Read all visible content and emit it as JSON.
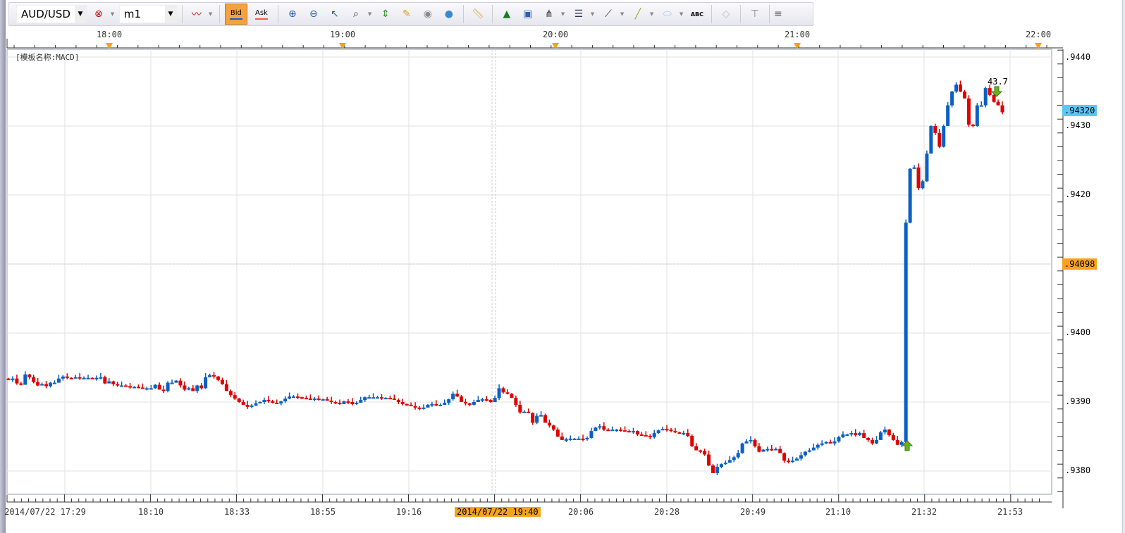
{
  "toolbar": {
    "symbol": "AUD/USD",
    "timeframe": "m1",
    "bid_label": "Bid",
    "ask_label": "Ask",
    "icons": [
      "delete-link-icon",
      "chart-type-icon",
      "zoom-in-icon",
      "zoom-out-icon",
      "pointer-icon",
      "zoom-range-icon",
      "vertical-fit-icon",
      "edit-icon",
      "view-icon",
      "globe-icon",
      "ruler-icon",
      "add-image-icon",
      "window-chart-icon",
      "fork-icon",
      "fib-lines-icon",
      "fan-icon",
      "line-tool-icon",
      "ellipse-icon",
      "text-tool-icon",
      "eraser-icon",
      "hierarchy-icon"
    ]
  },
  "colors": {
    "up": "#0a5fc4",
    "down": "#e00000",
    "current": "#5bc6f5",
    "cross": "#f7a21a",
    "grid": "#e2e2e2"
  },
  "top_axis": {
    "labels": [
      "18:00",
      "19:00",
      "20:00",
      "21:00",
      "22:00"
    ]
  },
  "template_label": "[模板名称:MACD]",
  "price_axis": {
    "labels": [
      ".9440",
      ".9430",
      ".9420",
      ".9400",
      ".9390",
      ".9380"
    ],
    "current": ".94320",
    "crosshair": ".94098"
  },
  "time_axis": {
    "labels": [
      "2014/07/22 17:29",
      "18:10",
      "18:33",
      "18:55",
      "19:16",
      "20:06",
      "20:28",
      "20:49",
      "21:10",
      "21:32",
      "21:53"
    ],
    "crosshair": "2014/07/22 19:40"
  },
  "marker_label": "43.7",
  "chart_data": {
    "type": "candlestick",
    "ylim": [
      0.9377,
      0.9442
    ],
    "closes": [
      0.93932,
      0.93934,
      0.93927,
      0.93925,
      0.9394,
      0.93936,
      0.93929,
      0.93924,
      0.93926,
      0.93923,
      0.93928,
      0.93928,
      0.93934,
      0.93937,
      0.93935,
      0.93934,
      0.93936,
      0.93935,
      0.93935,
      0.93935,
      0.93934,
      0.93935,
      0.93936,
      0.93927,
      0.9393,
      0.93926,
      0.93924,
      0.93924,
      0.93923,
      0.93922,
      0.93922,
      0.93921,
      0.9392,
      0.9392,
      0.9392,
      0.93925,
      0.93918,
      0.93916,
      0.93928,
      0.93928,
      0.93931,
      0.93924,
      0.93918,
      0.9392,
      0.93916,
      0.93924,
      0.9392,
      0.93936,
      0.93939,
      0.93937,
      0.93932,
      0.93926,
      0.93916,
      0.9391,
      0.93905,
      0.939,
      0.93896,
      0.93893,
      0.93895,
      0.93898,
      0.939,
      0.93903,
      0.93901,
      0.93899,
      0.93898,
      0.93901,
      0.93905,
      0.93908,
      0.93908,
      0.93907,
      0.93906,
      0.93905,
      0.93904,
      0.93905,
      0.93904,
      0.93904,
      0.93902,
      0.939,
      0.93899,
      0.93897,
      0.93901,
      0.939,
      0.93897,
      0.93899,
      0.93903,
      0.93907,
      0.93907,
      0.93907,
      0.93907,
      0.93906,
      0.93906,
      0.93905,
      0.93903,
      0.939,
      0.93897,
      0.93896,
      0.93894,
      0.93892,
      0.9389,
      0.93892,
      0.93896,
      0.93897,
      0.93896,
      0.93896,
      0.93899,
      0.93904,
      0.93912,
      0.93908,
      0.939,
      0.93898,
      0.93896,
      0.939,
      0.93903,
      0.93904,
      0.93903,
      0.939,
      0.93906,
      0.9392,
      0.93914,
      0.93912,
      0.93906,
      0.93896,
      0.93885,
      0.93886,
      0.93884,
      0.9387,
      0.9388,
      0.93881,
      0.9387,
      0.93866,
      0.9386,
      0.9385,
      0.93845,
      0.93846,
      0.93847,
      0.93847,
      0.93847,
      0.93846,
      0.93848,
      0.93858,
      0.93863,
      0.93865,
      0.9386,
      0.93859,
      0.9386,
      0.9386,
      0.93859,
      0.93858,
      0.93857,
      0.93858,
      0.93853,
      0.93852,
      0.93851,
      0.93849,
      0.93855,
      0.93859,
      0.93861,
      0.9386,
      0.93858,
      0.93856,
      0.93855,
      0.93855,
      0.93851,
      0.93836,
      0.9383,
      0.93829,
      0.93824,
      0.93808,
      0.93797,
      0.93806,
      0.9381,
      0.93812,
      0.93816,
      0.9382,
      0.93826,
      0.9384,
      0.93843,
      0.93845,
      0.93836,
      0.93828,
      0.93831,
      0.93832,
      0.93831,
      0.93832,
      0.93826,
      0.93815,
      0.93813,
      0.93815,
      0.93818,
      0.93823,
      0.93828,
      0.9383,
      0.93834,
      0.93838,
      0.9384,
      0.93842,
      0.9384,
      0.93843,
      0.93849,
      0.93853,
      0.93853,
      0.93855,
      0.93852,
      0.93855,
      0.93848,
      0.93845,
      0.9384,
      0.93845,
      0.93856,
      0.9386,
      0.93852,
      0.93845,
      0.93838,
      0.93842,
      0.9416,
      0.94238,
      0.9424,
      0.9421,
      0.9422,
      0.9426,
      0.943,
      0.9429,
      0.9427,
      0.943,
      0.9433,
      0.9435,
      0.9436,
      0.9435,
      0.9434,
      0.94302,
      0.943,
      0.9433,
      0.9433,
      0.94355,
      0.94345,
      0.94335,
      0.9433,
      0.9432
    ]
  }
}
